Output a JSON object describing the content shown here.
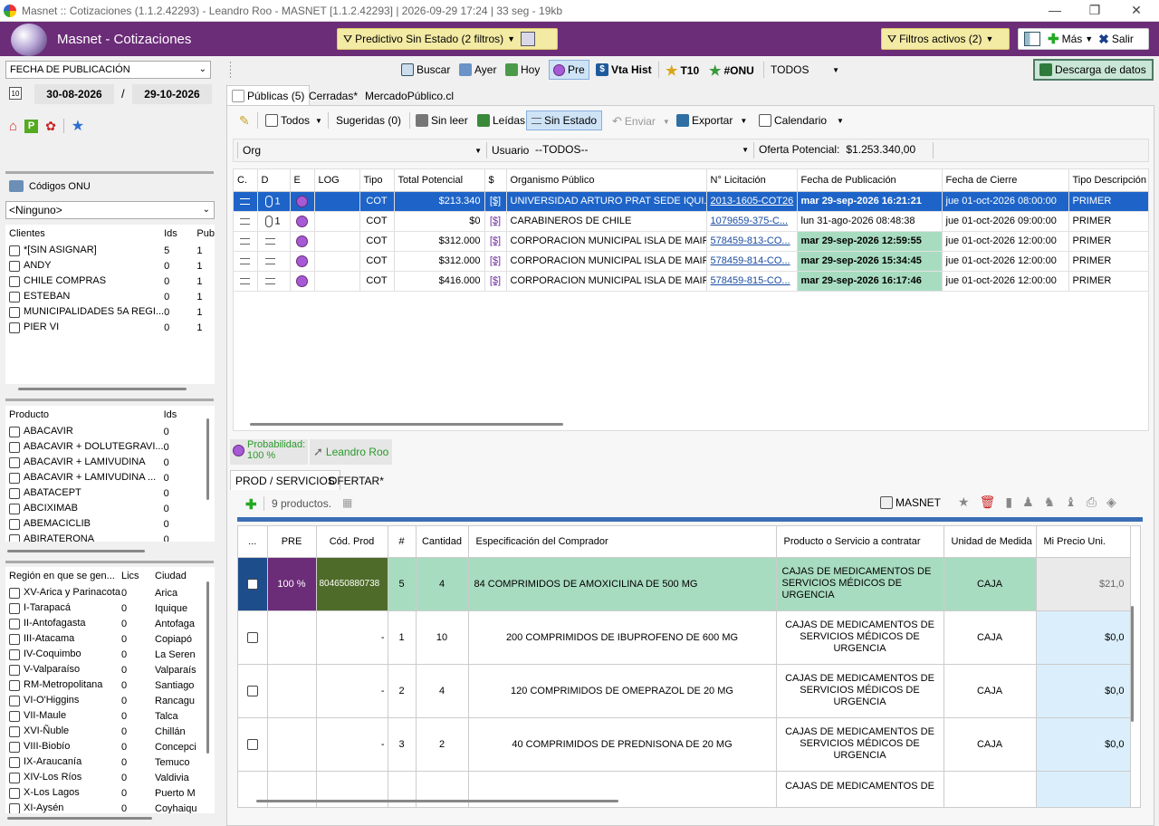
{
  "window": {
    "title": "Masnet :: Cotizaciones (1.1.2.42293) - Leandro Roo - MASNET [1.1.2.42293] | 2026-09-29 17:24 | 33 seg - 19kb"
  },
  "header": {
    "app_title": "Masnet - Cotizaciones",
    "predictive": "Predictivo Sin Estado (2 filtros)",
    "filters": "Filtros activos (2)",
    "more": "Más",
    "exit": "Salir"
  },
  "left": {
    "date_field": "FECHA DE PUBLICACIÓN",
    "date_from": "30-08-2026",
    "date_sep": "/",
    "date_to": "29-10-2026",
    "onu_label": "Códigos ONU",
    "onu_select": "<Ninguno>",
    "clients_headers": [
      "Clientes",
      "Ids",
      "Pub"
    ],
    "clients": [
      {
        "name": "*[SIN ASIGNAR]",
        "ids": "5",
        "pub": "1"
      },
      {
        "name": "ANDY",
        "ids": "0",
        "pub": "1"
      },
      {
        "name": "CHILE COMPRAS",
        "ids": "0",
        "pub": "1"
      },
      {
        "name": "ESTEBAN",
        "ids": "0",
        "pub": "1"
      },
      {
        "name": "MUNICIPALIDADES 5A REGI...",
        "ids": "0",
        "pub": "1"
      },
      {
        "name": "PIER VI",
        "ids": "0",
        "pub": "1"
      }
    ],
    "products_headers": [
      "Producto",
      "Ids"
    ],
    "products": [
      {
        "name": "ABACAVIR",
        "ids": "0"
      },
      {
        "name": "ABACAVIR + DOLUTEGRAVI...",
        "ids": "0"
      },
      {
        "name": "ABACAVIR + LAMIVUDINA",
        "ids": "0"
      },
      {
        "name": "ABACAVIR + LAMIVUDINA ...",
        "ids": "0"
      },
      {
        "name": "ABATACEPT",
        "ids": "0"
      },
      {
        "name": "ABCIXIMAB",
        "ids": "0"
      },
      {
        "name": "ABEMACICLIB",
        "ids": "0"
      },
      {
        "name": "ABIRATERONA",
        "ids": "0"
      }
    ],
    "regions_headers": [
      "Región en que se gen...",
      "Lics",
      "Ciudad"
    ],
    "regions": [
      {
        "name": "XV-Arica y Parinacota",
        "lics": "0",
        "city": "Arica"
      },
      {
        "name": "I-Tarapacá",
        "lics": "0",
        "city": "Iquique"
      },
      {
        "name": "II-Antofagasta",
        "lics": "0",
        "city": "Antofaga"
      },
      {
        "name": "III-Atacama",
        "lics": "0",
        "city": "Copiapó"
      },
      {
        "name": "IV-Coquimbo",
        "lics": "0",
        "city": "La Seren"
      },
      {
        "name": "V-Valparaíso",
        "lics": "0",
        "city": "Valparaís"
      },
      {
        "name": "RM-Metropolitana",
        "lics": "0",
        "city": "Santiago"
      },
      {
        "name": "VI-O'Higgins",
        "lics": "0",
        "city": "Rancagu"
      },
      {
        "name": "VII-Maule",
        "lics": "0",
        "city": "Talca"
      },
      {
        "name": "XVI-Ñuble",
        "lics": "0",
        "city": "Chillán"
      },
      {
        "name": "VIII-Biobío",
        "lics": "0",
        "city": "Concepci"
      },
      {
        "name": "IX-Araucanía",
        "lics": "0",
        "city": "Temuco"
      },
      {
        "name": "XIV-Los Ríos",
        "lics": "0",
        "city": "Valdivia"
      },
      {
        "name": "X-Los Lagos",
        "lics": "0",
        "city": "Puerto M"
      },
      {
        "name": "XI-Aysén",
        "lics": "0",
        "city": "Coyhaiqu"
      }
    ]
  },
  "toolbar1": {
    "buscar": "Buscar",
    "ayer": "Ayer",
    "hoy": "Hoy",
    "pre": "Pre",
    "vtahist": "Vta Hist",
    "t10": "T10",
    "onu": "#ONU",
    "todos": "TODOS",
    "descarga": "Descarga de datos"
  },
  "tabs": [
    "Públicas (5)",
    "Cerradas*",
    "MercadoPúblico.cl"
  ],
  "toolbar2": {
    "todos": "Todos",
    "sugeridas": "Sugeridas (0)",
    "sinleer": "Sin leer",
    "leidas": "Leídas",
    "sinestado": "Sin Estado",
    "enviar": "Enviar",
    "exportar": "Exportar",
    "calendario": "Calendario"
  },
  "filterbar": {
    "org_label": "Org",
    "usuario_label": "Usuario",
    "usuario_value": "--TODOS--",
    "oferta_label": "Oferta Potencial:",
    "oferta_value": "$1.253.340,00"
  },
  "grid": {
    "headers": [
      "C.",
      "D",
      "E",
      "LOG",
      "Tipo",
      "Total Potencial",
      "$",
      "Organismo Público",
      "N° Licitación",
      "Fecha de Publicación",
      "Fecha de Cierre",
      "Tipo Descripción"
    ],
    "rows": [
      {
        "d": "1",
        "tipo": "COT",
        "total": "$213.340",
        "money": "[$]",
        "org": "UNIVERSIDAD ARTURO PRAT SEDE IQUI...",
        "lic": "2013-1605-COT26",
        "pub": "mar 29-sep-2026 16:21:21",
        "cierre": "jue 01-oct-2026 08:00:00",
        "desc": "PRIMER"
      },
      {
        "d": "1",
        "tipo": "COT",
        "total": "$0",
        "money": "[$]",
        "org": "CARABINEROS DE CHILE",
        "lic": "1079659-375-C...",
        "pub": "lun 31-ago-2026 08:48:38",
        "cierre": "jue 01-oct-2026 09:00:00",
        "desc": "PRIMER"
      },
      {
        "d": "",
        "tipo": "COT",
        "total": "$312.000",
        "money": "[$]",
        "org": "CORPORACION MUNICIPAL ISLA DE MAIPO",
        "lic": "578459-813-CO...",
        "pub": "mar 29-sep-2026 12:59:55",
        "cierre": "jue 01-oct-2026 12:00:00",
        "desc": "PRIMER"
      },
      {
        "d": "",
        "tipo": "COT",
        "total": "$312.000",
        "money": "[$]",
        "org": "CORPORACION MUNICIPAL ISLA DE MAIPO",
        "lic": "578459-814-CO...",
        "pub": "mar 29-sep-2026 15:34:45",
        "cierre": "jue 01-oct-2026 12:00:00",
        "desc": "PRIMER"
      },
      {
        "d": "",
        "tipo": "COT",
        "total": "$416.000",
        "money": "[$]",
        "org": "CORPORACION MUNICIPAL ISLA DE MAIPO",
        "lic": "578459-815-CO...",
        "pub": "mar 29-sep-2026 16:17:46",
        "cierre": "jue 01-oct-2026 12:00:00",
        "desc": "PRIMER"
      }
    ]
  },
  "status": {
    "prob_label": "Probabilidad:",
    "prob_value": "100 %",
    "user": "Leandro Roo"
  },
  "bottom_tabs": [
    "PROD / SERVICIOS",
    "OFERTAR*"
  ],
  "bottom_toolbar": {
    "count": "9 productos.",
    "masnet": "MASNET"
  },
  "prod": {
    "headers": [
      "...",
      "PRE",
      "Cód. Prod",
      "#",
      "Cantidad",
      "Especificación del Comprador",
      "Producto o Servicio a contratar",
      "Unidad de Medida",
      "Mi Precio Uni."
    ],
    "rows": [
      {
        "pre": "100 %",
        "code": "804650880738",
        "num": "5",
        "qty": "4",
        "spec": "84 COMPRIMIDOS DE AMOXICILINA DE 500 MG",
        "product": "CAJAS DE MEDICAMENTOS DE SERVICIOS MÉDICOS DE URGENCIA",
        "unit": "CAJA",
        "price": "$21,0"
      },
      {
        "pre": "",
        "code": "-",
        "num": "1",
        "qty": "10",
        "spec": "200 COMPRIMIDOS DE IBUPROFENO DE 600 MG",
        "product": "CAJAS DE MEDICAMENTOS DE SERVICIOS MÉDICOS DE URGENCIA",
        "unit": "CAJA",
        "price": "$0,0"
      },
      {
        "pre": "",
        "code": "-",
        "num": "2",
        "qty": "4",
        "spec": "120 COMPRIMIDOS DE OMEPRAZOL DE 20 MG",
        "product": "CAJAS DE MEDICAMENTOS DE SERVICIOS MÉDICOS DE URGENCIA",
        "unit": "CAJA",
        "price": "$0,0"
      },
      {
        "pre": "",
        "code": "-",
        "num": "3",
        "qty": "2",
        "spec": "40 COMPRIMIDOS DE PREDNISONA DE 20 MG",
        "product": "CAJAS DE MEDICAMENTOS DE SERVICIOS MÉDICOS DE URGENCIA",
        "unit": "CAJA",
        "price": "$0,0"
      },
      {
        "pre": "",
        "code": "",
        "num": "",
        "qty": "",
        "spec": "",
        "product": "CAJAS DE MEDICAMENTOS DE",
        "unit": "",
        "price": ""
      }
    ]
  },
  "colors": {
    "brand": "#6b2c78",
    "selection": "#1e64c8",
    "accent_green": "#a8dcc0"
  }
}
